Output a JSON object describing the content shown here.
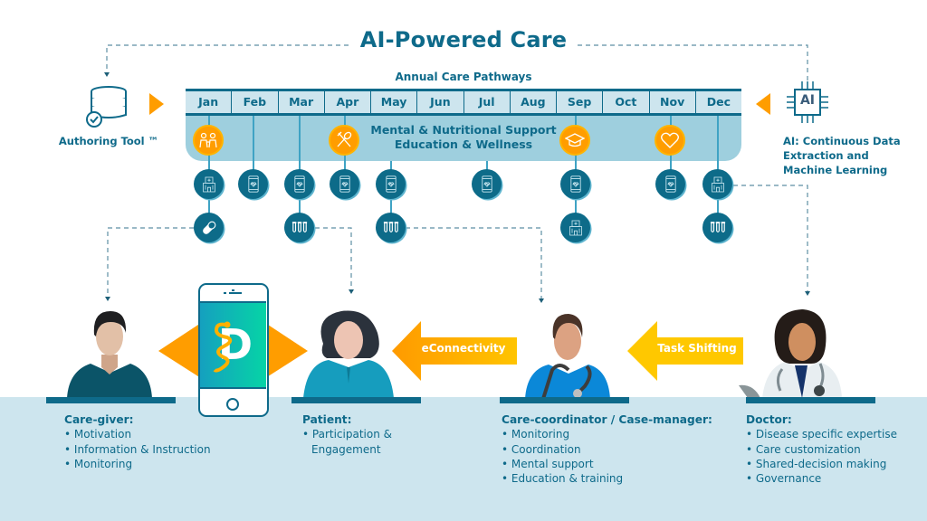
{
  "title": "AI-Powered Care",
  "pathways": {
    "title": "Annual Care Pathways",
    "months": [
      "Jan",
      "Feb",
      "Mar",
      "Apr",
      "May",
      "Jun",
      "Jul",
      "Aug",
      "Sep",
      "Oct",
      "Nov",
      "Dec"
    ],
    "band_text": [
      "Mental & Nutritional Support",
      "Education & Wellness"
    ],
    "milestones": [
      {
        "month": "Jan",
        "icon": "people-icon"
      },
      {
        "month": "Apr",
        "icon": "fork-spoon-icon"
      },
      {
        "month": "Sep",
        "icon": "graduation-cap-icon"
      },
      {
        "month": "Nov",
        "icon": "heart-icon"
      }
    ],
    "nodes_row1": [
      {
        "month": "Jan",
        "icon": "hospital-icon"
      },
      {
        "month": "Feb",
        "icon": "phone-heartbeat-icon"
      },
      {
        "month": "Mar",
        "icon": "phone-heartbeat-icon"
      },
      {
        "month": "Apr",
        "icon": "phone-heartbeat-icon"
      },
      {
        "month": "May",
        "icon": "phone-heartbeat-icon"
      },
      {
        "month": "Jul",
        "icon": "phone-heartbeat-icon"
      },
      {
        "month": "Sep",
        "icon": "phone-heartbeat-icon"
      },
      {
        "month": "Nov",
        "icon": "phone-heartbeat-icon"
      },
      {
        "month": "Dec",
        "icon": "hospital-icon"
      }
    ],
    "nodes_row2": [
      {
        "month": "Jan",
        "icon": "pill-icon"
      },
      {
        "month": "Mar",
        "icon": "test-tubes-icon"
      },
      {
        "month": "May",
        "icon": "test-tubes-icon"
      },
      {
        "month": "Sep",
        "icon": "hospital-icon"
      },
      {
        "month": "Dec",
        "icon": "test-tubes-icon"
      }
    ]
  },
  "authoring_tool": {
    "label": "Authoring Tool ™",
    "icon": "database-check-icon"
  },
  "ai": {
    "chip_text": "AI",
    "label_lines": [
      "AI: Continuous Data",
      "Extraction and",
      "Machine Learning"
    ]
  },
  "arrows": {
    "econnectivity": "eConnectivity",
    "task_shifting": "Task Shifting"
  },
  "app": {
    "logo_letter": "D"
  },
  "roles": [
    {
      "title": "Care-giver:",
      "items": [
        "Motivation",
        "Information & Instruction",
        "Monitoring"
      ]
    },
    {
      "title": "Patient:",
      "items": [
        "Participation &",
        "Engagement"
      ]
    },
    {
      "title": "Care-coordinator / Case-manager:",
      "items": [
        "Monitoring",
        "Coordination",
        "Mental support",
        "Education & training"
      ]
    },
    {
      "title": "Doctor:",
      "items": [
        "Disease specific expertise",
        "Care customization",
        "Shared-decision making",
        "Governance"
      ]
    }
  ],
  "colors": {
    "primary": "#0e6a8a",
    "orange": "#ff9d00",
    "yellow": "#ffc800",
    "band_light": "#cde5ee",
    "band_mid": "#9ecfde"
  }
}
